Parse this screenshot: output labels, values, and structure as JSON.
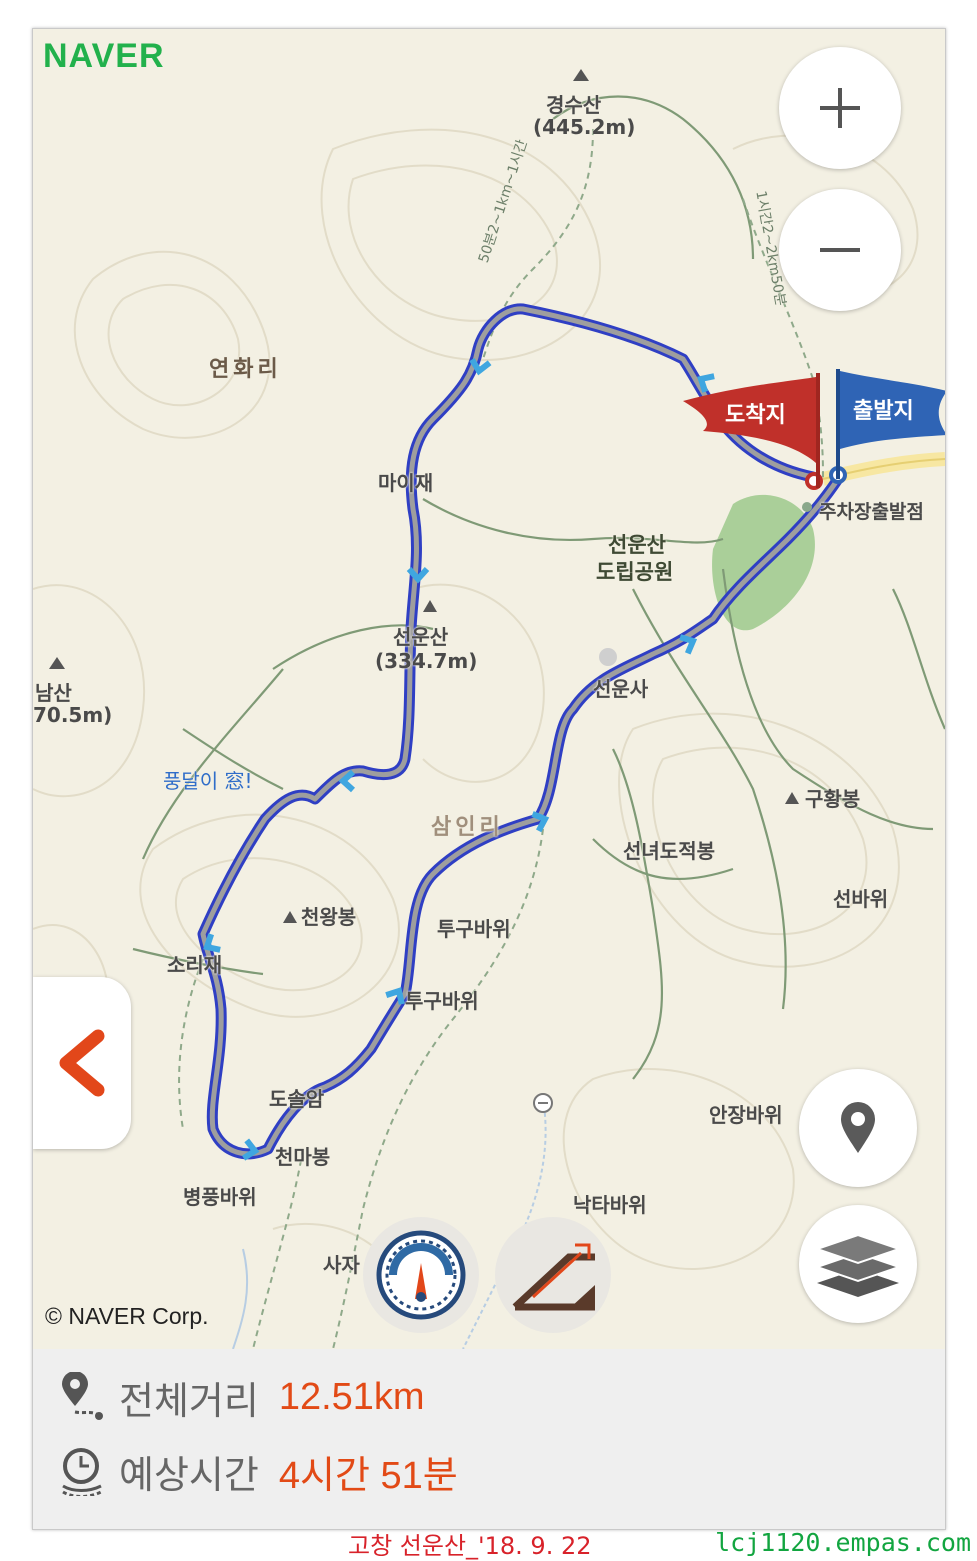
{
  "app": {
    "logo": "NAVER",
    "copyright": "© NAVER Corp."
  },
  "map_labels": {
    "peak_gyeongsu": "경수산",
    "peak_gyeongsu_elev": "(445.2m)",
    "village_yeonhwa": "연화리",
    "pass_madeul": "마이재",
    "park_line1": "선운산",
    "park_line2": "도립공원",
    "peak_seonun": "선운산",
    "peak_seonun_elev": "(334.7m)",
    "peak_nam": "남산",
    "peak_nam_elev": "70.5m)",
    "temple": "선운사",
    "trail_note": "풍달이 窓!",
    "area_samin": "삼인리",
    "peak_guhwang": "구황봉",
    "peak_cheonwang": "천왕봉",
    "rock_tugu1": "투구바위",
    "rock_tugu2": "투구바위",
    "peak_seonyeo": "선녀도적봉",
    "rock_seon": "선바위",
    "pass_somal": "소리재",
    "hermitage": "도솔암",
    "peak_cheonma": "천마봉",
    "rock_anjang": "안장바위",
    "rock_byeongpung": "병풍바위",
    "rock_nakta": "낙타바위",
    "rock_saja": "사자",
    "parking": "주차장출발점",
    "trail_time_left": "50분2~1km~1시간",
    "trail_time_right": "1시간2~2km50분"
  },
  "flags": {
    "arrival": "도착지",
    "departure": "출발지"
  },
  "controls": {
    "zoom_in": "+",
    "zoom_out": "−",
    "icons": [
      "plus-icon",
      "minus-icon",
      "chevron-left-icon",
      "location-pin-icon",
      "layers-icon",
      "speedometer-icon",
      "slope-icon"
    ]
  },
  "summary": {
    "distance_label": "전체거리",
    "distance_value": "12.51km",
    "time_label": "예상시간",
    "time_value": "4시간 51분"
  },
  "colors": {
    "route_outline": "#2f3fc4",
    "route_fill": "#9a9a9a",
    "arrival_flag": "#c0302a",
    "departure_flag": "#2f64b5",
    "accent_value": "#e24a16",
    "logo": "#22b14c"
  },
  "footer": {
    "caption": "고창 선운산_'18. 9. 22",
    "site": "lcj1120.empas.com"
  }
}
